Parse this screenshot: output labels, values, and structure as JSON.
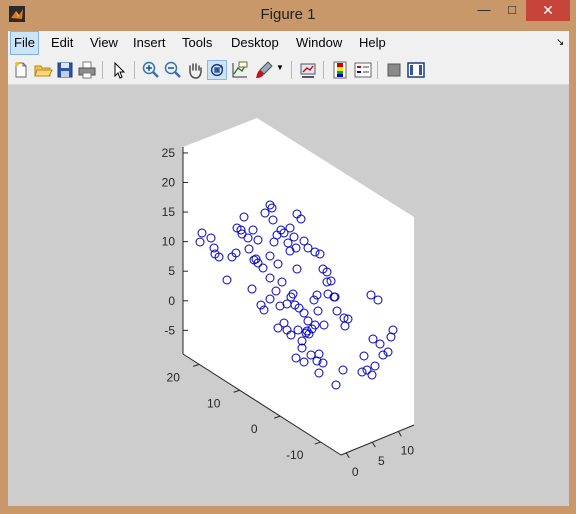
{
  "window": {
    "title": "Figure 1",
    "minimize": "—",
    "maximize": "□",
    "close": "✕"
  },
  "menu": [
    "File",
    "Edit",
    "View",
    "Insert",
    "Tools",
    "Desktop",
    "Window",
    "Help"
  ],
  "toolbar_icons": [
    "new-figure-icon",
    "open-file-icon",
    "save-icon",
    "print-icon",
    "edit-plot-arrow-icon",
    "zoom-in-icon",
    "zoom-out-icon",
    "pan-hand-icon",
    "rotate-3d-icon",
    "data-cursor-icon",
    "brush-icon",
    "dropdown-icon",
    "link-plot-icon",
    "colorbar-icon",
    "legend-icon",
    "hide-plot-tools-icon",
    "show-plot-tools-icon"
  ],
  "colors": {
    "marker": "#0000cc",
    "axes_bg": "#ffffff",
    "figure_bg": "#cdcdcd"
  },
  "chart_data": {
    "type": "scatter",
    "view": "3d",
    "marker": "open-circle",
    "zticks": [
      "25",
      "20",
      "15",
      "10",
      "5",
      "0",
      "-5"
    ],
    "yticks": [
      "20",
      "10",
      "0",
      "-10"
    ],
    "xticks": [
      "0",
      "5",
      "10"
    ],
    "zlim": [
      -9,
      26
    ],
    "ylim": [
      -15,
      24
    ],
    "xlim": [
      -1,
      13
    ],
    "title": "",
    "xlabel": "",
    "ylabel": "",
    "zlabel": ""
  }
}
